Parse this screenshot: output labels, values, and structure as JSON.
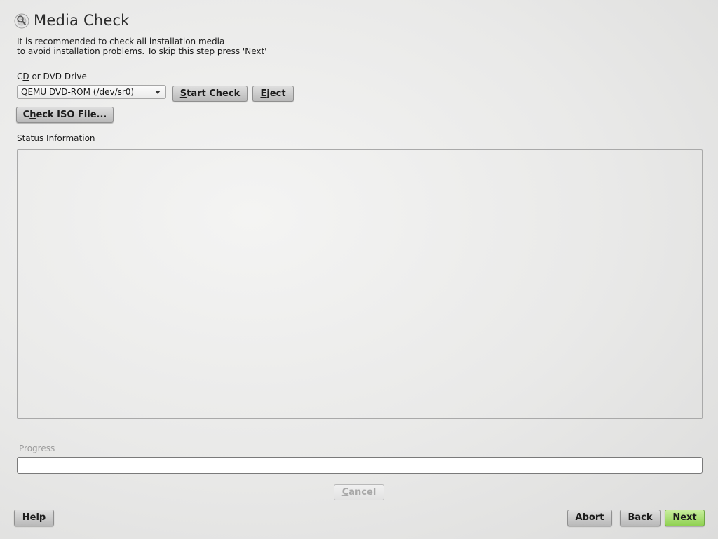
{
  "header": {
    "icon": "media-check-disc-icon",
    "title": "Media Check"
  },
  "intro": {
    "line1": "It is recommended to check all installation media",
    "line2": "to avoid installation problems. To skip this step press 'Next'"
  },
  "drive": {
    "label_pre": "C",
    "label_accel": "D",
    "label_post": " or DVD Drive",
    "selected": "QEMU DVD-ROM (/dev/sr0)"
  },
  "buttons": {
    "start_check": {
      "accel": "S",
      "rest": "tart Check"
    },
    "eject": {
      "accel": "E",
      "rest": "ject"
    },
    "check_iso": {
      "pre": "C",
      "accel": "h",
      "rest": "eck ISO File..."
    },
    "cancel": {
      "accel": "C",
      "rest": "ancel"
    },
    "help": {
      "label": "Help"
    },
    "abort": {
      "pre": "Abo",
      "accel": "r",
      "rest": "t"
    },
    "back": {
      "accel": "B",
      "rest": "ack"
    },
    "next": {
      "accel": "N",
      "rest": "ext"
    }
  },
  "status": {
    "label": "Status Information",
    "content": ""
  },
  "progress": {
    "label": "Progress",
    "value": 0
  },
  "colors": {
    "next_button": "#8fd151",
    "progress_fill": "#6fae3f"
  }
}
